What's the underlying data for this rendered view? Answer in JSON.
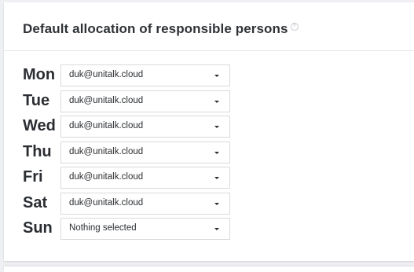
{
  "panel": {
    "title": "Default allocation of responsible persons",
    "help_icon": "question-circle-icon"
  },
  "schedule": [
    {
      "day": "Mon",
      "value": "duk@unitalk.cloud"
    },
    {
      "day": "Tue",
      "value": "duk@unitalk.cloud"
    },
    {
      "day": "Wed",
      "value": "duk@unitalk.cloud"
    },
    {
      "day": "Thu",
      "value": "duk@unitalk.cloud"
    },
    {
      "day": "Fri",
      "value": "duk@unitalk.cloud"
    },
    {
      "day": "Sat",
      "value": "duk@unitalk.cloud"
    },
    {
      "day": "Sun",
      "value": "Nothing selected"
    }
  ],
  "colors": {
    "background": "#eef0f3",
    "panel": "#ffffff",
    "text": "#2f3337",
    "border": "#d7dadd"
  }
}
